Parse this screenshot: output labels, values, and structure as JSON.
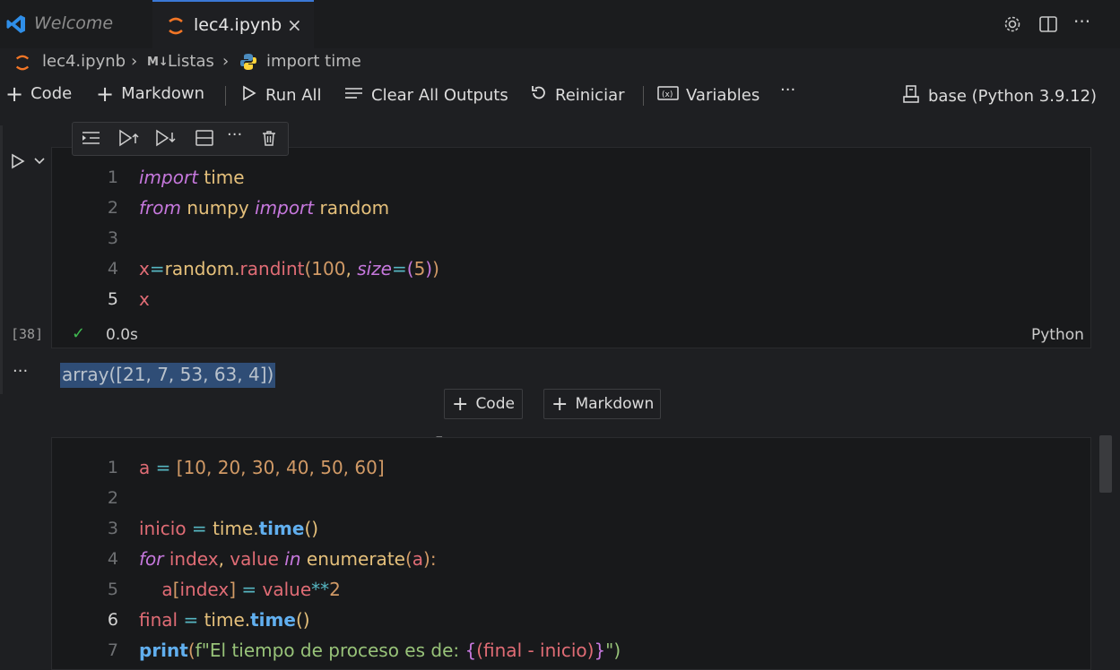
{
  "tabs": {
    "welcome": "Welcome",
    "active": "lec4.ipynb",
    "close": "×"
  },
  "breadcrumb": {
    "file": "lec4.ipynb",
    "section": "Listas",
    "section_prefix": "M↓",
    "cell": "import time"
  },
  "toolbar": {
    "add_code": "Code",
    "add_markdown": "Markdown",
    "run_all": "Run All",
    "clear_outputs": "Clear All Outputs",
    "restart": "Reiniciar",
    "variables": "Variables",
    "more": "···",
    "kernel": "base (Python 3.9.12)"
  },
  "cell1": {
    "exec_count": "[38]",
    "status_time": "0.0s",
    "language": "Python",
    "line_numbers": [
      "1",
      "2",
      "3",
      "4",
      "5"
    ],
    "lines": [
      [
        {
          "t": "import",
          "c": "kw"
        },
        {
          "t": " time",
          "c": "id"
        }
      ],
      [
        {
          "t": "from",
          "c": "kw"
        },
        {
          "t": " numpy ",
          "c": "id"
        },
        {
          "t": "import",
          "c": "kw"
        },
        {
          "t": " random",
          "c": "id"
        }
      ],
      [],
      [
        {
          "t": "x",
          "c": "var"
        },
        {
          "t": "=",
          "c": "op"
        },
        {
          "t": "random",
          "c": "id"
        },
        {
          "t": ".",
          "c": "id"
        },
        {
          "t": "randint",
          "c": "var"
        },
        {
          "t": "(",
          "c": "br1"
        },
        {
          "t": "100",
          "c": "num"
        },
        {
          "t": ", ",
          "c": "id"
        },
        {
          "t": "size",
          "c": "kw"
        },
        {
          "t": "=",
          "c": "op"
        },
        {
          "t": "(",
          "c": "br2"
        },
        {
          "t": "5",
          "c": "num"
        },
        {
          "t": ")",
          "c": "br2"
        },
        {
          "t": ")",
          "c": "br1"
        }
      ],
      [
        {
          "t": "x",
          "c": "var"
        }
      ]
    ],
    "output": "array([21,  7, 53, 63,  4])"
  },
  "insert_buttons": {
    "code": "Code",
    "markdown": "Markdown"
  },
  "cell2": {
    "line_numbers": [
      "1",
      "2",
      "3",
      "4",
      "5",
      "6",
      "7"
    ],
    "lines": [
      [
        {
          "t": "a",
          "c": "var"
        },
        {
          "t": " = ",
          "c": "op"
        },
        {
          "t": "[",
          "c": "br1"
        },
        {
          "t": "10, 20, 30, 40, 50, 60",
          "c": "num"
        },
        {
          "t": "]",
          "c": "br1"
        }
      ],
      [],
      [
        {
          "t": "inicio",
          "c": "var"
        },
        {
          "t": " = ",
          "c": "op"
        },
        {
          "t": "time",
          "c": "id"
        },
        {
          "t": ".",
          "c": "id"
        },
        {
          "t": "time",
          "c": "blue"
        },
        {
          "t": "()",
          "c": "id"
        }
      ],
      [
        {
          "t": "for",
          "c": "kw"
        },
        {
          "t": " index",
          "c": "var"
        },
        {
          "t": ", ",
          "c": "id"
        },
        {
          "t": "value",
          "c": "var"
        },
        {
          "t": " in ",
          "c": "kw"
        },
        {
          "t": "enumerate",
          "c": "id"
        },
        {
          "t": "(",
          "c": "br1"
        },
        {
          "t": "a",
          "c": "var"
        },
        {
          "t": "):",
          "c": "br1"
        }
      ],
      [
        {
          "t": "    a",
          "c": "var"
        },
        {
          "t": "[",
          "c": "br1"
        },
        {
          "t": "index",
          "c": "var"
        },
        {
          "t": "]",
          "c": "br1"
        },
        {
          "t": " = ",
          "c": "op"
        },
        {
          "t": "value",
          "c": "var"
        },
        {
          "t": "**",
          "c": "op"
        },
        {
          "t": "2",
          "c": "num"
        }
      ],
      [
        {
          "t": "final",
          "c": "var"
        },
        {
          "t": " = ",
          "c": "op"
        },
        {
          "t": "time",
          "c": "id"
        },
        {
          "t": ".",
          "c": "id"
        },
        {
          "t": "time",
          "c": "blue"
        },
        {
          "t": "()",
          "c": "id"
        }
      ],
      [
        {
          "t": "print",
          "c": "blue"
        },
        {
          "t": "(",
          "c": "br1"
        },
        {
          "t": "f\"El tiempo de proceso es de: ",
          "c": "str"
        },
        {
          "t": "{",
          "c": "br2"
        },
        {
          "t": "(final - inicio)",
          "c": "var"
        },
        {
          "t": "}",
          "c": "br2"
        },
        {
          "t": "\")",
          "c": "str"
        }
      ]
    ]
  }
}
